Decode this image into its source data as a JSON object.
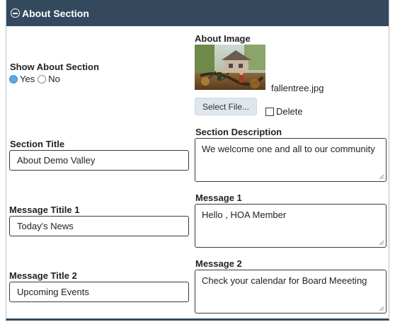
{
  "header": {
    "title": "About Section",
    "icon": "minus-circle-icon"
  },
  "show_about": {
    "label": "Show About Section",
    "options": [
      "Yes",
      "No"
    ],
    "selected": "Yes"
  },
  "about_image": {
    "label": "About Image",
    "filename": "fallentree.jpg",
    "select_button": "Select File...",
    "delete_label": "Delete",
    "delete_checked": false
  },
  "section_title": {
    "label": "Section Title",
    "value": "About Demo Valley"
  },
  "section_description": {
    "label": "Section Description",
    "value": "We welcome one and all to our community"
  },
  "message_title_1": {
    "label": "Message Titile 1",
    "value": "Today's News"
  },
  "message_1": {
    "label": "Message 1",
    "value": "Hello , HOA Member"
  },
  "message_title_2": {
    "label": "Message Title 2",
    "value": "Upcoming Events"
  },
  "message_2": {
    "label": "Message 2",
    "value": "Check your calendar for Board Meeeting"
  },
  "colors": {
    "header_bg": "#34495e",
    "radio_selected": "#5aa9e6",
    "button_bg": "#dfe6ee"
  }
}
